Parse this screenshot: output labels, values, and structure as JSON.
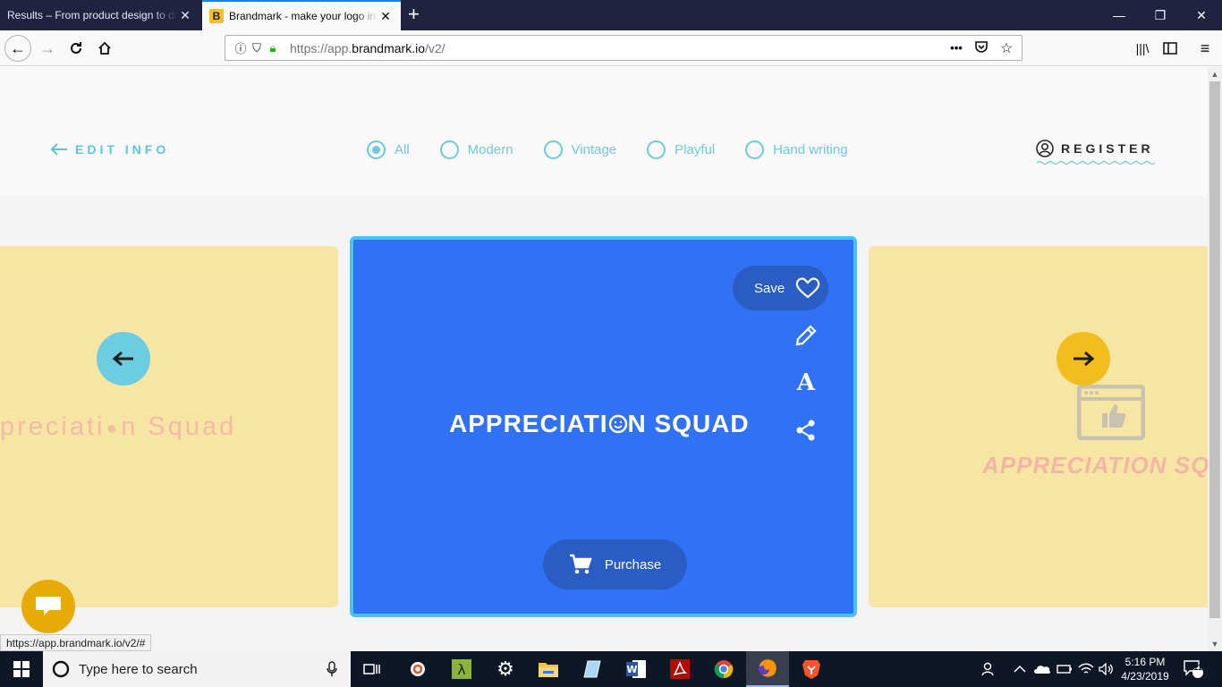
{
  "browser": {
    "tabs": [
      {
        "title": "Results – From product design to di",
        "active": false
      },
      {
        "title": "Brandmark - make your logo in",
        "active": true
      }
    ],
    "url_prefix": "https://app.",
    "url_domain": "brandmark.io",
    "url_path": "/v2/",
    "status_url": "https://app.brandmark.io/v2/#"
  },
  "header": {
    "edit_info": "EDIT INFO",
    "register": "REGISTER",
    "filters": [
      {
        "label": "All",
        "checked": true
      },
      {
        "label": "Modern",
        "checked": false
      },
      {
        "label": "Vintage",
        "checked": false
      },
      {
        "label": "Playful",
        "checked": false
      },
      {
        "label": "Hand writing",
        "checked": false
      }
    ]
  },
  "cards": {
    "left_logo_text": "preciati",
    "left_logo_text_end": "n Squad",
    "center_logo_a": "APPRECIATI",
    "center_logo_b": "N SQUAD",
    "right_logo_text": "APPRECIATION SQU",
    "save_label": "Save",
    "purchase_label": "Purchase"
  },
  "taskbar": {
    "search_placeholder": "Type here to search",
    "time": "5:16 PM",
    "date": "4/23/2019",
    "notification_count": "11"
  },
  "colors": {
    "accent": "#6fcad8",
    "card_center": "#3172f5",
    "card_side": "#f7e5a3",
    "button_dark": "#2a5dc4",
    "chat": "#e8aa06"
  }
}
